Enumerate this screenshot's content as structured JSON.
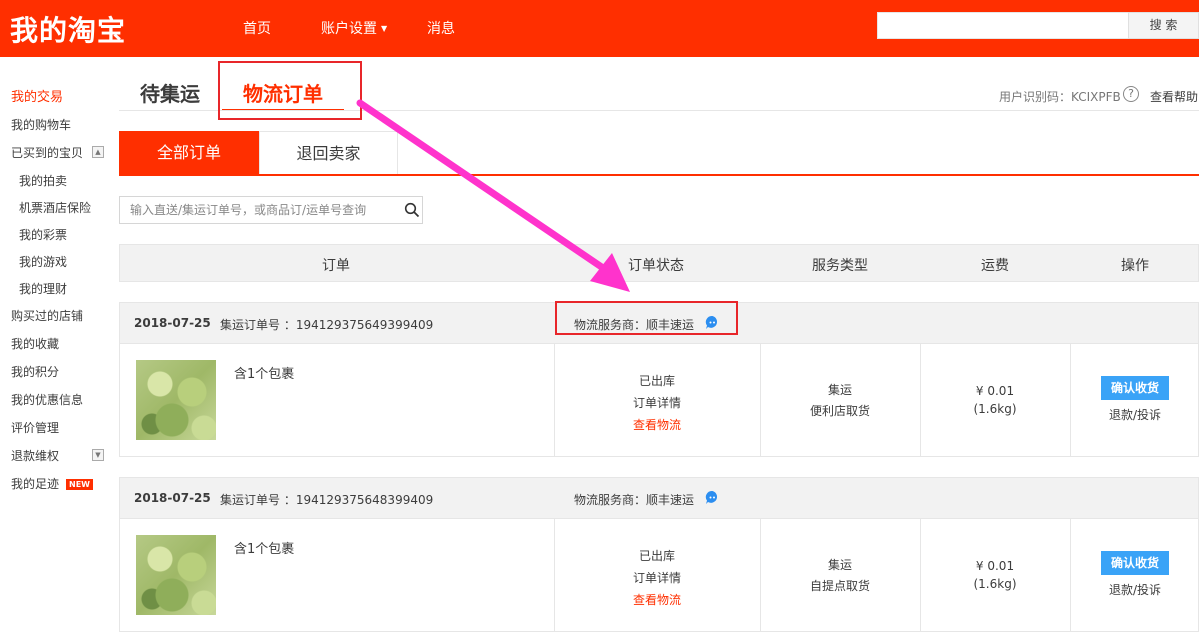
{
  "header": {
    "logo": "我的淘宝",
    "nav": {
      "home": "首页",
      "account": "账户设置",
      "messages": "消息"
    },
    "search_button": "搜 索"
  },
  "sidebar": {
    "items": [
      {
        "label": "我的交易"
      },
      {
        "label": "我的购物车"
      },
      {
        "label": "已买到的宝贝"
      },
      {
        "label": "我的拍卖"
      },
      {
        "label": "机票酒店保险"
      },
      {
        "label": "我的彩票"
      },
      {
        "label": "我的游戏"
      },
      {
        "label": "我的理财"
      },
      {
        "label": "购买过的店铺"
      },
      {
        "label": "我的收藏"
      },
      {
        "label": "我的积分"
      },
      {
        "label": "我的优惠信息"
      },
      {
        "label": "评价管理"
      },
      {
        "label": "退款维权"
      },
      {
        "label": "我的足迹"
      }
    ],
    "new_badge": "NEW"
  },
  "tabs": {
    "pending": "待集运",
    "logistics": "物流订单"
  },
  "user": {
    "id_text": "用户识别码：KCIXPFB",
    "help_icon": "?",
    "help": "查看帮助"
  },
  "subtabs": {
    "all": "全部订单",
    "return": "退回卖家"
  },
  "order_search": {
    "placeholder": "输入直送/集运订单号，或商品订/运单号查询"
  },
  "table": {
    "headers": {
      "order": "订单",
      "status": "订单状态",
      "service": "服务类型",
      "fee": "运费",
      "op": "操作"
    }
  },
  "orders": [
    {
      "date": "2018-07-25",
      "order_no": "集运订单号 ：194129375649399409",
      "carrier": "物流服务商：顺丰速运",
      "package": "含1个包裹",
      "status": "已出库",
      "detail": "订单详情",
      "track": "查看物流",
      "service_type": "集运",
      "service_mode": "便利店取货",
      "fee": "¥ 0.01",
      "weight": "(1.6kg)",
      "confirm": "确认收货",
      "refund": "退款/投诉"
    },
    {
      "date": "2018-07-25",
      "order_no": "集运订单号 ：194129375648399409",
      "carrier": "物流服务商：顺丰速运",
      "package": "含1个包裹",
      "status": "已出库",
      "detail": "订单详情",
      "track": "查看物流",
      "service_type": "集运",
      "service_mode": "自提点取货",
      "fee": "¥ 0.01",
      "weight": "(1.6kg)",
      "confirm": "确认收货",
      "refund": "退款/投诉"
    }
  ],
  "colors": {
    "brand": "#ff2f00",
    "confirm_button": "#3aa3f7",
    "annotation": "#ff33cc",
    "highlight_box": "#e8262a"
  }
}
